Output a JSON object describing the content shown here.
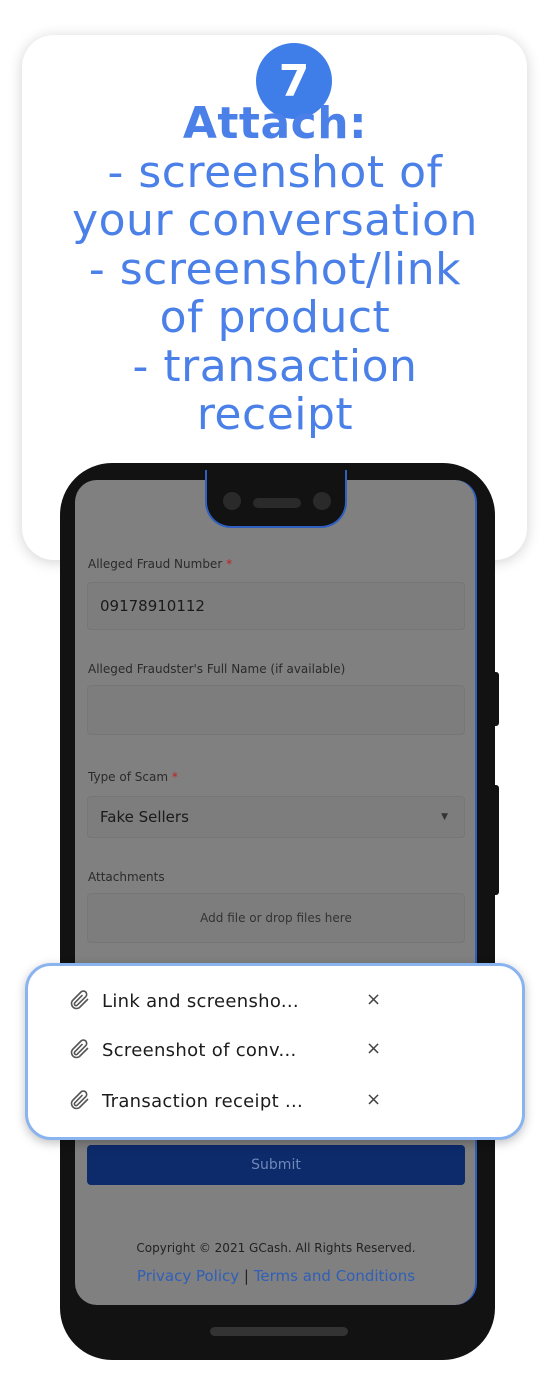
{
  "step": {
    "number": "7",
    "title_lines": [
      "Attach:",
      "- screenshot of",
      "your conversation",
      "- screenshot/link",
      "of product",
      "- transaction",
      "receipt"
    ]
  },
  "form": {
    "fraud_number": {
      "label": "Alleged Fraud Number",
      "required": "*",
      "value": "09178910112"
    },
    "fraudster_name": {
      "label": "Alleged Fraudster's Full Name (if available)",
      "value": ""
    },
    "scam_type": {
      "label": "Type of Scam",
      "required": "*",
      "value": "Fake Sellers"
    },
    "attachments": {
      "label": "Attachments",
      "dropzone": "Add file or drop files here"
    },
    "submit_label": "Submit"
  },
  "attached_files": [
    {
      "name": "Link and screensho...",
      "icon": "paperclip-icon",
      "remove": "×"
    },
    {
      "name": "Screenshot of conv...",
      "icon": "paperclip-icon",
      "remove": "×"
    },
    {
      "name": "Transaction receipt ...",
      "icon": "paperclip-icon",
      "remove": "×"
    }
  ],
  "footer": {
    "copyright": "Copyright © 2021 GCash. All Rights Reserved.",
    "privacy": "Privacy Policy",
    "separator": "|",
    "terms": "Terms and Conditions"
  },
  "colors": {
    "accent": "#3f7de8",
    "submit": "#0d2a6b",
    "popup_border": "#8ab4ef"
  }
}
